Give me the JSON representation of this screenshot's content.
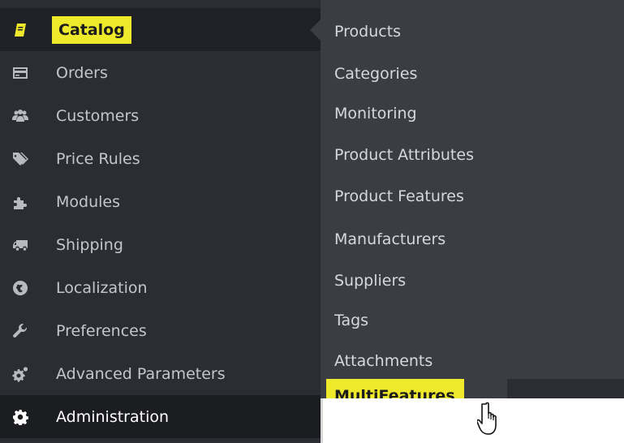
{
  "sidebar": {
    "items": [
      {
        "label": "Catalog",
        "icon": "book-icon",
        "active": true
      },
      {
        "label": "Orders",
        "icon": "credit-card-icon"
      },
      {
        "label": "Customers",
        "icon": "users-icon"
      },
      {
        "label": "Price Rules",
        "icon": "tags-icon"
      },
      {
        "label": "Modules",
        "icon": "puzzle-icon"
      },
      {
        "label": "Shipping",
        "icon": "truck-icon"
      },
      {
        "label": "Localization",
        "icon": "globe-icon"
      },
      {
        "label": "Preferences",
        "icon": "wrench-icon"
      },
      {
        "label": "Advanced Parameters",
        "icon": "cogs-icon"
      },
      {
        "label": "Administration",
        "icon": "gear-icon"
      }
    ]
  },
  "submenu": {
    "items": [
      {
        "label": "Products"
      },
      {
        "label": "Categories"
      },
      {
        "label": "Monitoring"
      },
      {
        "label": "Product Attributes"
      },
      {
        "label": "Product Features"
      },
      {
        "label": "Manufacturers"
      },
      {
        "label": "Suppliers"
      },
      {
        "label": "Tags"
      },
      {
        "label": "Attachments"
      },
      {
        "label": "MultiFeatures",
        "highlighted": true
      }
    ]
  },
  "colors": {
    "sidebar_bg": "#2b2d33",
    "submenu_bg": "#3a3d43",
    "highlight": "#efe92b",
    "text": "#c3c6cb"
  }
}
